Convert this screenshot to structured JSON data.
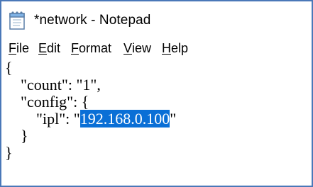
{
  "window": {
    "title": "*network - Notepad",
    "icon": "notepad-icon"
  },
  "menu": [
    {
      "first": "F",
      "rest": "ile"
    },
    {
      "first": "E",
      "rest": "dit"
    },
    {
      "first": "F",
      "rest": "ormat"
    },
    {
      "first": "V",
      "rest": "iew"
    },
    {
      "first": "H",
      "rest": "elp"
    }
  ],
  "editor": {
    "line1": "{",
    "line2": "    \"count\": \"1\",",
    "line3": "    \"config\": {",
    "line4_before": "        \"ipl\": \"",
    "line4_selected": "192.168.0.100",
    "line4_after": "\"",
    "line5": "    }",
    "line6": "}"
  },
  "colors": {
    "selection": "#0a6fd6",
    "window_border": "#4a78b8"
  }
}
